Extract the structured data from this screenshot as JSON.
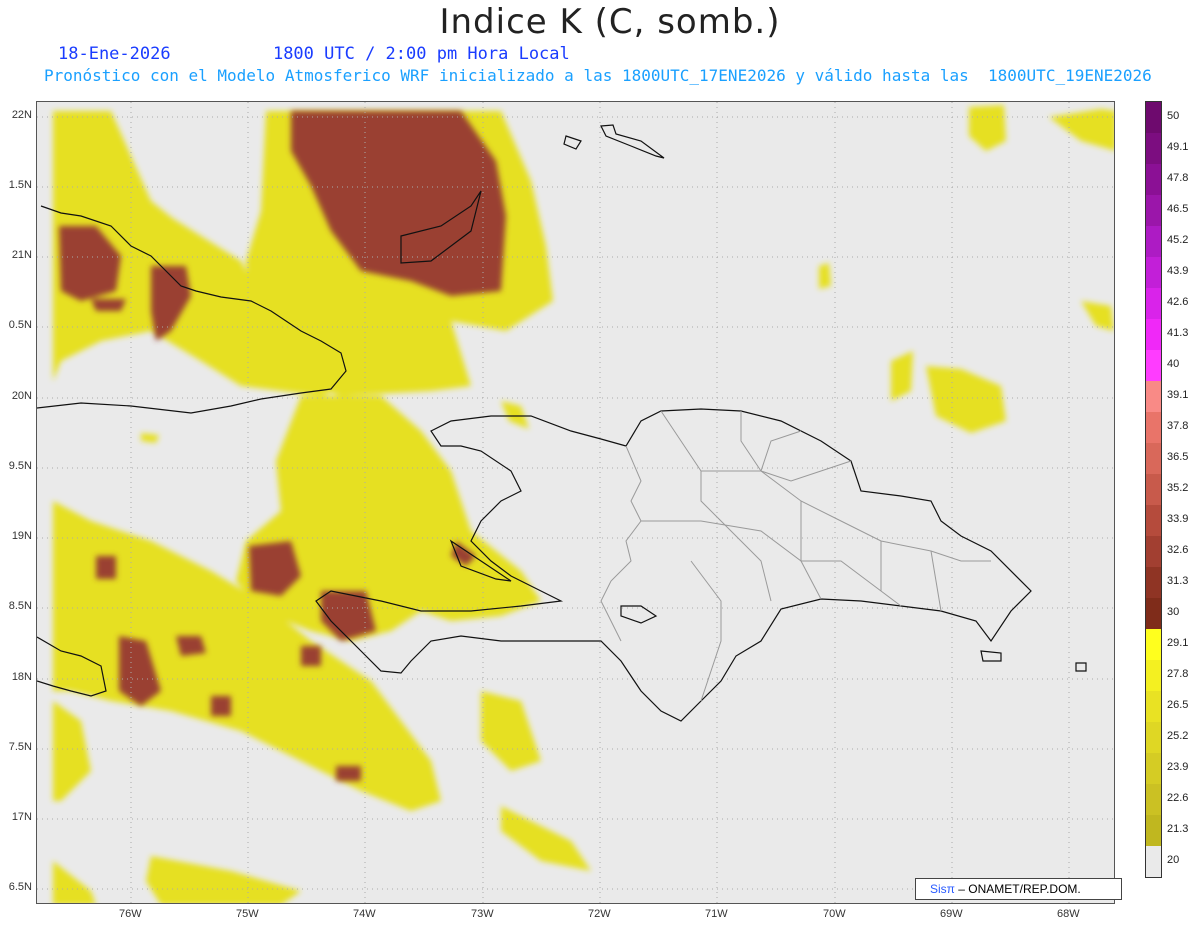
{
  "header": {
    "title": "Indice K (C, somb.)",
    "date": "18-Ene-2026",
    "time": "1800 UTC / 2:00 pm Hora Local",
    "description": "Pronóstico con el Modelo Atmosferico WRF inicializado a las 1800UTC_17ENE2026 y válido hasta las  1800UTC_19ENE2026"
  },
  "axes": {
    "lat_labels": [
      "22N",
      "1.5N",
      "21N",
      "0.5N",
      "20N",
      "9.5N",
      "19N",
      "8.5N",
      "18N",
      "7.5N",
      "17N",
      "6.5N"
    ],
    "lon_labels": [
      "76W",
      "75W",
      "74W",
      "73W",
      "72W",
      "71W",
      "70W",
      "69W",
      "68W"
    ]
  },
  "colorbar": {
    "labels": [
      "50",
      "49.1",
      "47.8",
      "46.5",
      "45.2",
      "43.9",
      "42.6",
      "41.3",
      "40",
      "39.1",
      "37.8",
      "36.5",
      "35.2",
      "33.9",
      "32.6",
      "31.3",
      "30",
      "29.1",
      "27.8",
      "26.5",
      "25.2",
      "23.9",
      "22.6",
      "21.3",
      "20"
    ],
    "colors": [
      "#6e0a6e",
      "#7c0d80",
      "#8b1095",
      "#9b16aa",
      "#ad1bc4",
      "#c21fd8",
      "#d923ea",
      "#f028f8",
      "#ff3cff",
      "#f98a86",
      "#e97469",
      "#d9685a",
      "#c85a4b",
      "#b54b3c",
      "#a23f31",
      "#8f3424",
      "#7f2c1a",
      "#ffff1e",
      "#f4f021",
      "#e9e223",
      "#dfd724",
      "#d5cc24",
      "#cbc123",
      "#c0b71f",
      "#eaeaea"
    ]
  },
  "credit": {
    "brand": "Sisπ",
    "text": "– ONAMET/REP.DOM."
  }
}
